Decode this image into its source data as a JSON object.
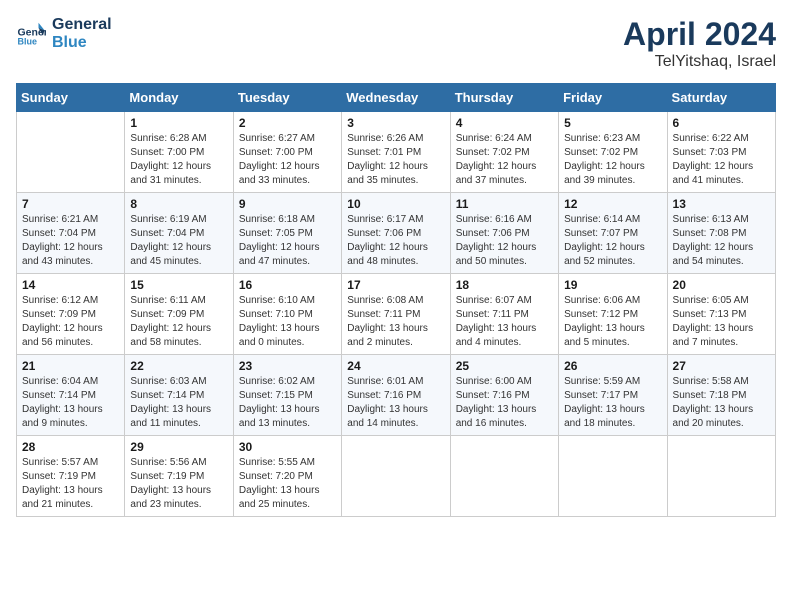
{
  "header": {
    "logo_line1": "General",
    "logo_line2": "Blue",
    "month": "April 2024",
    "location": "TelYitshaq, Israel"
  },
  "days_of_week": [
    "Sunday",
    "Monday",
    "Tuesday",
    "Wednesday",
    "Thursday",
    "Friday",
    "Saturday"
  ],
  "weeks": [
    [
      {
        "day": "",
        "info": ""
      },
      {
        "day": "1",
        "info": "Sunrise: 6:28 AM\nSunset: 7:00 PM\nDaylight: 12 hours\nand 31 minutes."
      },
      {
        "day": "2",
        "info": "Sunrise: 6:27 AM\nSunset: 7:00 PM\nDaylight: 12 hours\nand 33 minutes."
      },
      {
        "day": "3",
        "info": "Sunrise: 6:26 AM\nSunset: 7:01 PM\nDaylight: 12 hours\nand 35 minutes."
      },
      {
        "day": "4",
        "info": "Sunrise: 6:24 AM\nSunset: 7:02 PM\nDaylight: 12 hours\nand 37 minutes."
      },
      {
        "day": "5",
        "info": "Sunrise: 6:23 AM\nSunset: 7:02 PM\nDaylight: 12 hours\nand 39 minutes."
      },
      {
        "day": "6",
        "info": "Sunrise: 6:22 AM\nSunset: 7:03 PM\nDaylight: 12 hours\nand 41 minutes."
      }
    ],
    [
      {
        "day": "7",
        "info": "Sunrise: 6:21 AM\nSunset: 7:04 PM\nDaylight: 12 hours\nand 43 minutes."
      },
      {
        "day": "8",
        "info": "Sunrise: 6:19 AM\nSunset: 7:04 PM\nDaylight: 12 hours\nand 45 minutes."
      },
      {
        "day": "9",
        "info": "Sunrise: 6:18 AM\nSunset: 7:05 PM\nDaylight: 12 hours\nand 47 minutes."
      },
      {
        "day": "10",
        "info": "Sunrise: 6:17 AM\nSunset: 7:06 PM\nDaylight: 12 hours\nand 48 minutes."
      },
      {
        "day": "11",
        "info": "Sunrise: 6:16 AM\nSunset: 7:06 PM\nDaylight: 12 hours\nand 50 minutes."
      },
      {
        "day": "12",
        "info": "Sunrise: 6:14 AM\nSunset: 7:07 PM\nDaylight: 12 hours\nand 52 minutes."
      },
      {
        "day": "13",
        "info": "Sunrise: 6:13 AM\nSunset: 7:08 PM\nDaylight: 12 hours\nand 54 minutes."
      }
    ],
    [
      {
        "day": "14",
        "info": "Sunrise: 6:12 AM\nSunset: 7:09 PM\nDaylight: 12 hours\nand 56 minutes."
      },
      {
        "day": "15",
        "info": "Sunrise: 6:11 AM\nSunset: 7:09 PM\nDaylight: 12 hours\nand 58 minutes."
      },
      {
        "day": "16",
        "info": "Sunrise: 6:10 AM\nSunset: 7:10 PM\nDaylight: 13 hours\nand 0 minutes."
      },
      {
        "day": "17",
        "info": "Sunrise: 6:08 AM\nSunset: 7:11 PM\nDaylight: 13 hours\nand 2 minutes."
      },
      {
        "day": "18",
        "info": "Sunrise: 6:07 AM\nSunset: 7:11 PM\nDaylight: 13 hours\nand 4 minutes."
      },
      {
        "day": "19",
        "info": "Sunrise: 6:06 AM\nSunset: 7:12 PM\nDaylight: 13 hours\nand 5 minutes."
      },
      {
        "day": "20",
        "info": "Sunrise: 6:05 AM\nSunset: 7:13 PM\nDaylight: 13 hours\nand 7 minutes."
      }
    ],
    [
      {
        "day": "21",
        "info": "Sunrise: 6:04 AM\nSunset: 7:14 PM\nDaylight: 13 hours\nand 9 minutes."
      },
      {
        "day": "22",
        "info": "Sunrise: 6:03 AM\nSunset: 7:14 PM\nDaylight: 13 hours\nand 11 minutes."
      },
      {
        "day": "23",
        "info": "Sunrise: 6:02 AM\nSunset: 7:15 PM\nDaylight: 13 hours\nand 13 minutes."
      },
      {
        "day": "24",
        "info": "Sunrise: 6:01 AM\nSunset: 7:16 PM\nDaylight: 13 hours\nand 14 minutes."
      },
      {
        "day": "25",
        "info": "Sunrise: 6:00 AM\nSunset: 7:16 PM\nDaylight: 13 hours\nand 16 minutes."
      },
      {
        "day": "26",
        "info": "Sunrise: 5:59 AM\nSunset: 7:17 PM\nDaylight: 13 hours\nand 18 minutes."
      },
      {
        "day": "27",
        "info": "Sunrise: 5:58 AM\nSunset: 7:18 PM\nDaylight: 13 hours\nand 20 minutes."
      }
    ],
    [
      {
        "day": "28",
        "info": "Sunrise: 5:57 AM\nSunset: 7:19 PM\nDaylight: 13 hours\nand 21 minutes."
      },
      {
        "day": "29",
        "info": "Sunrise: 5:56 AM\nSunset: 7:19 PM\nDaylight: 13 hours\nand 23 minutes."
      },
      {
        "day": "30",
        "info": "Sunrise: 5:55 AM\nSunset: 7:20 PM\nDaylight: 13 hours\nand 25 minutes."
      },
      {
        "day": "",
        "info": ""
      },
      {
        "day": "",
        "info": ""
      },
      {
        "day": "",
        "info": ""
      },
      {
        "day": "",
        "info": ""
      }
    ]
  ]
}
